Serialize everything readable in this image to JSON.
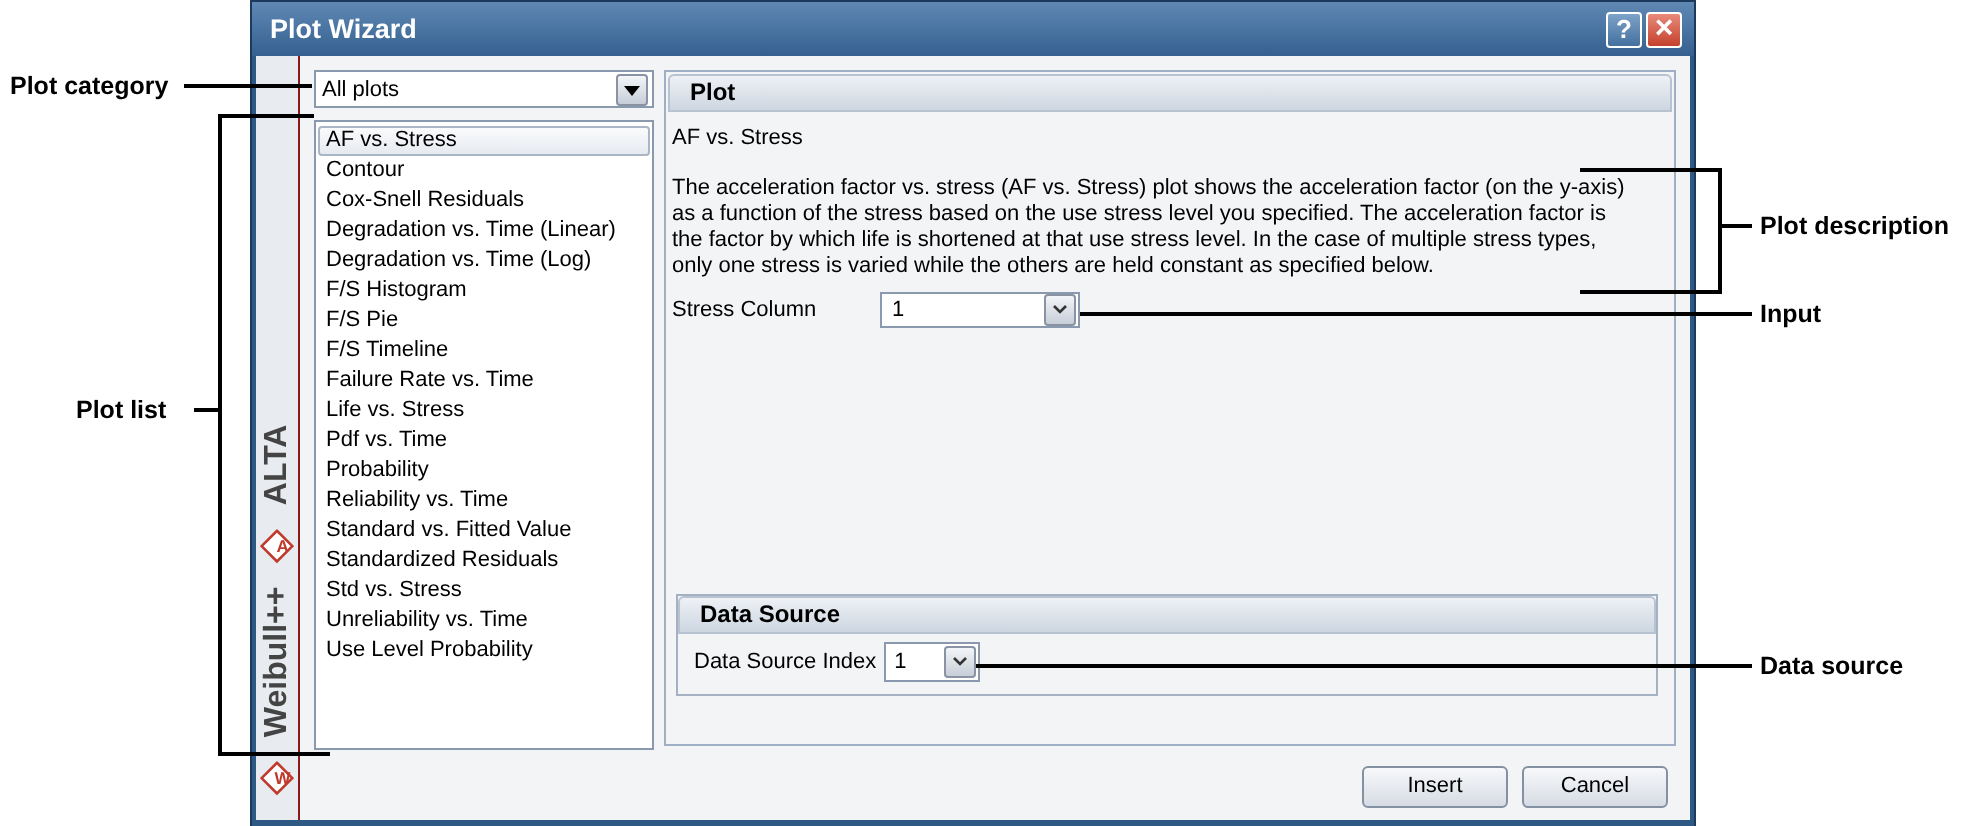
{
  "window": {
    "title": "Plot Wizard",
    "controls": [
      {
        "kind": "help",
        "glyph": "?"
      },
      {
        "kind": "close",
        "glyph": "×"
      }
    ]
  },
  "sidebar": {
    "products": [
      {
        "name": "ALTA",
        "badge": "A"
      },
      {
        "name": "Weibull++",
        "badge": "W"
      }
    ]
  },
  "category": {
    "value": "All plots"
  },
  "plot_list": [
    {
      "label": "AF vs. Stress",
      "selected": true
    },
    {
      "label": "Contour",
      "selected": false
    },
    {
      "label": "Cox-Snell Residuals",
      "selected": false
    },
    {
      "label": "Degradation vs. Time (Linear)",
      "selected": false
    },
    {
      "label": "Degradation vs. Time (Log)",
      "selected": false
    },
    {
      "label": "F/S Histogram",
      "selected": false
    },
    {
      "label": "F/S Pie",
      "selected": false
    },
    {
      "label": "F/S Timeline",
      "selected": false
    },
    {
      "label": "Failure Rate vs. Time",
      "selected": false
    },
    {
      "label": "Life vs. Stress",
      "selected": false
    },
    {
      "label": "Pdf vs. Time",
      "selected": false
    },
    {
      "label": "Probability",
      "selected": false
    },
    {
      "label": "Reliability vs. Time",
      "selected": false
    },
    {
      "label": "Standard vs. Fitted Value",
      "selected": false
    },
    {
      "label": "Standardized Residuals",
      "selected": false
    },
    {
      "label": "Std vs. Stress",
      "selected": false
    },
    {
      "label": "Unreliability vs. Time",
      "selected": false
    },
    {
      "label": "Use Level Probability",
      "selected": false
    }
  ],
  "plot_panel": {
    "header": "Plot",
    "name": "AF vs. Stress",
    "description": "The acceleration factor vs. stress (AF vs. Stress) plot shows the acceleration factor (on the y-axis) as a function of the stress based on the use stress level you specified. The acceleration factor is the factor by which life is shortened at that use stress level. In the case of multiple stress types, only one stress is varied while the others are held constant as specified below.",
    "stress_column": {
      "label": "Stress Column",
      "value": "1"
    }
  },
  "data_source": {
    "header": "Data Source",
    "label": "Data Source Index",
    "value": "1"
  },
  "buttons": [
    "Insert",
    "Cancel"
  ],
  "annotations": [
    {
      "text": "Plot category"
    },
    {
      "text": "Plot list"
    },
    {
      "text": "Plot description"
    },
    {
      "text": "Input"
    },
    {
      "text": "Data source"
    }
  ]
}
